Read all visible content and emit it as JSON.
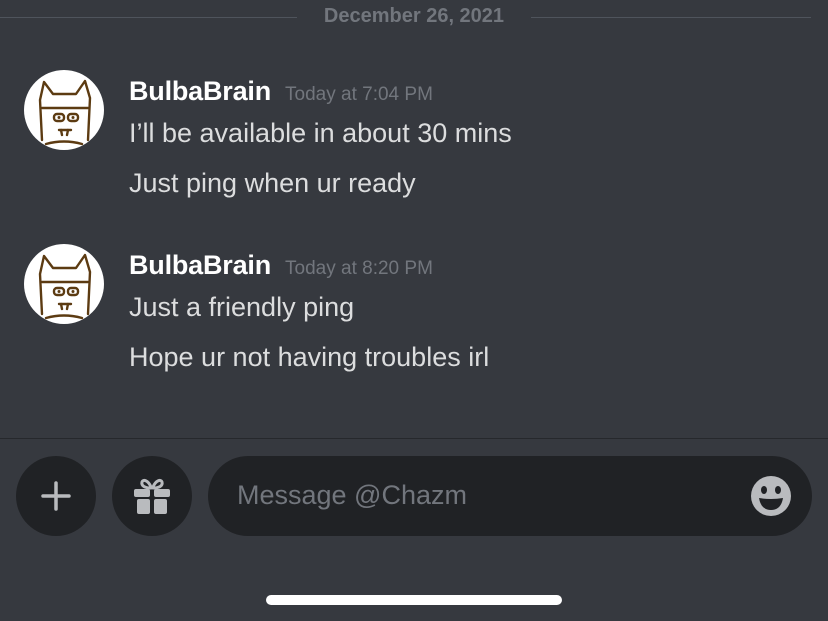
{
  "date_divider": {
    "label": "December 26, 2021"
  },
  "messages": [
    {
      "username": "BulbaBrain",
      "timestamp": "Today at 7:04 PM",
      "lines": [
        "I’ll be available in about 30 mins",
        "Just ping when ur ready"
      ]
    },
    {
      "username": "BulbaBrain",
      "timestamp": "Today at 8:20 PM",
      "lines": [
        "Just a friendly ping",
        "Hope ur not having troubles irl"
      ]
    }
  ],
  "composer": {
    "placeholder": "Message @Chazm",
    "buttons": {
      "add_icon": "plus-icon",
      "gift_icon": "gift-icon",
      "emoji_icon": "smile-emoji-icon"
    }
  },
  "colors": {
    "background": "#36393f",
    "input_background": "#202225",
    "username": "#ffffff",
    "message_text": "#dcddde",
    "muted_text": "#72767d",
    "avatar_drawing": "#5c3b12"
  }
}
